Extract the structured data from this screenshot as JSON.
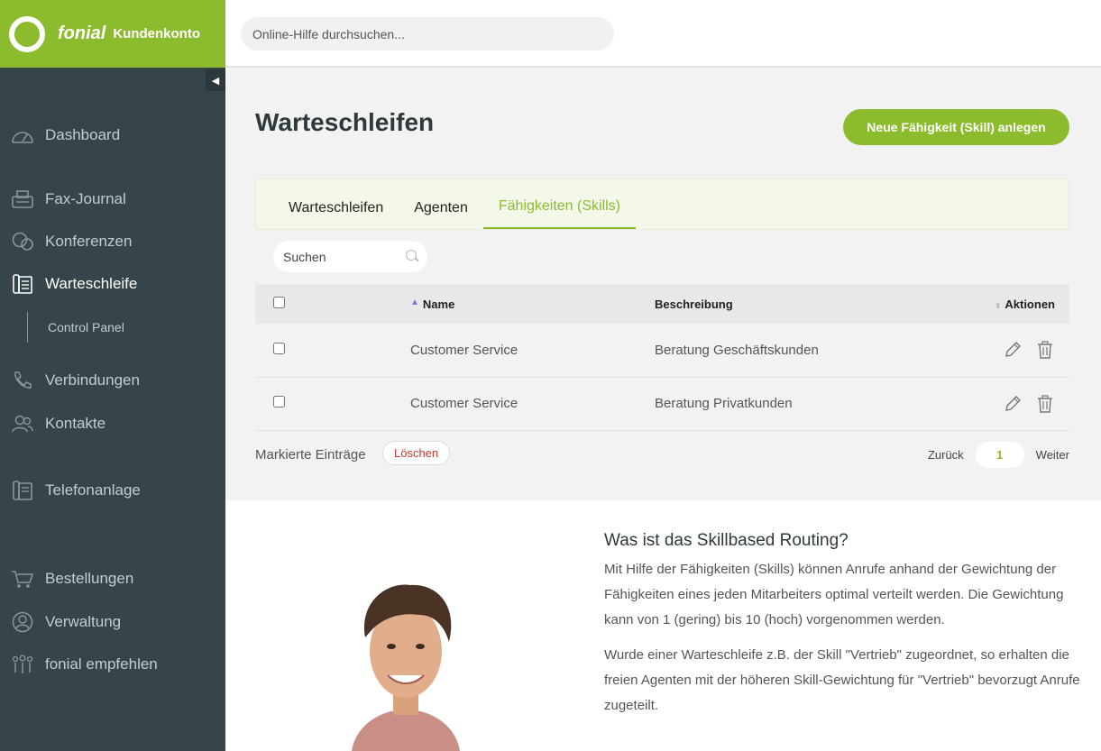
{
  "brand": {
    "name": "fonial",
    "sub": "Kundenkonto"
  },
  "topbar": {
    "search_placeholder": "Online-Hilfe durchsuchen..."
  },
  "sidebar": {
    "items": [
      {
        "label": "Dashboard",
        "icon": "speedometer-icon"
      },
      {
        "label": "Fax-Journal",
        "icon": "fax-icon"
      },
      {
        "label": "Konferenzen",
        "icon": "chat-bubbles-icon"
      },
      {
        "label": "Warteschleife",
        "icon": "queue-phone-icon"
      },
      {
        "label": "Control Panel",
        "icon": ""
      },
      {
        "label": "Verbindungen",
        "icon": "phone-icon"
      },
      {
        "label": "Kontakte",
        "icon": "contacts-icon"
      },
      {
        "label": "Telefonanlage",
        "icon": "pbx-icon"
      },
      {
        "label": "Bestellungen",
        "icon": "cart-icon"
      },
      {
        "label": "Verwaltung",
        "icon": "user-circle-icon"
      },
      {
        "label": "fonial empfehlen",
        "icon": "people-icon"
      }
    ]
  },
  "page": {
    "title": "Warteschleifen",
    "new_button": "Neue Fähigkeit (Skill) anlegen"
  },
  "tabs": [
    {
      "label": "Warteschleifen"
    },
    {
      "label": "Agenten"
    },
    {
      "label": "Fähigkeiten (Skills)"
    }
  ],
  "filter": {
    "placeholder": "Suchen"
  },
  "table": {
    "columns": {
      "name": "Name",
      "description": "Beschreibung",
      "actions": "Aktionen"
    },
    "rows": [
      {
        "name": "Customer Service",
        "description": "Beratung Geschäftskunden"
      },
      {
        "name": "Customer Service",
        "description": "Beratung Privatkunden"
      }
    ]
  },
  "bulk": {
    "label": "Markierte Einträge",
    "delete": "Löschen"
  },
  "pager": {
    "prev": "Zurück",
    "page": "1",
    "next": "Weiter"
  },
  "info": {
    "title": "Was ist das Skillbased Routing?",
    "p1": "Mit Hilfe der Fähigkeiten (Skills) können Anrufe anhand der Gewichtung der Fähigkeiten eines jeden Mitarbeiters optimal verteilt werden. Die Gewichtung kann von 1 (gering) bis 10 (hoch) vorgenommen werden.",
    "p2": "Wurde einer Warteschleife z.B. der Skill \"Vertrieb\" zugeordnet, so erhalten die freien Agenten mit der höheren Skill-Gewichtung für \"Vertrieb\" bevorzugt Anrufe zugeteilt."
  },
  "colors": {
    "brand_green": "#8dbb2e",
    "sidebar": "#354549",
    "delete_red": "#c0392b",
    "sort_blue": "#6b7fd9"
  }
}
